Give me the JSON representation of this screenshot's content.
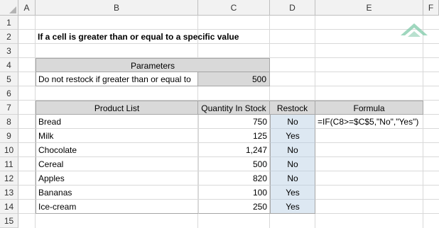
{
  "columns": [
    "A",
    "B",
    "C",
    "D",
    "E",
    "F"
  ],
  "rows": [
    "1",
    "2",
    "3",
    "4",
    "5",
    "6",
    "7",
    "8",
    "9",
    "10",
    "11",
    "12",
    "13",
    "14",
    "15"
  ],
  "title": "If a cell is greater than or equal to a specific value",
  "parameters": {
    "header": "Parameters",
    "label": "Do not restock if greater than or equal to",
    "value": "500"
  },
  "table": {
    "headers": {
      "product": "Product List",
      "quantity": "Quantity In Stock",
      "restock": "Restock",
      "formula": "Formula"
    },
    "rows": [
      {
        "product": "Bread",
        "quantity": "750",
        "restock": "No"
      },
      {
        "product": "Milk",
        "quantity": "125",
        "restock": "Yes"
      },
      {
        "product": "Chocolate",
        "quantity": "1,247",
        "restock": "No"
      },
      {
        "product": "Cereal",
        "quantity": "500",
        "restock": "No"
      },
      {
        "product": "Apples",
        "quantity": "820",
        "restock": "No"
      },
      {
        "product": "Bananas",
        "quantity": "100",
        "restock": "Yes"
      },
      {
        "product": "Ice-cream",
        "quantity": "250",
        "restock": "Yes"
      }
    ]
  },
  "formula": "=IF(C8>=$C$5,\"No\",\"Yes\")",
  "colors": {
    "header_fill": "#d9d9d9",
    "restock_fill": "#dde8f2",
    "logo": "#7fc9a8"
  }
}
